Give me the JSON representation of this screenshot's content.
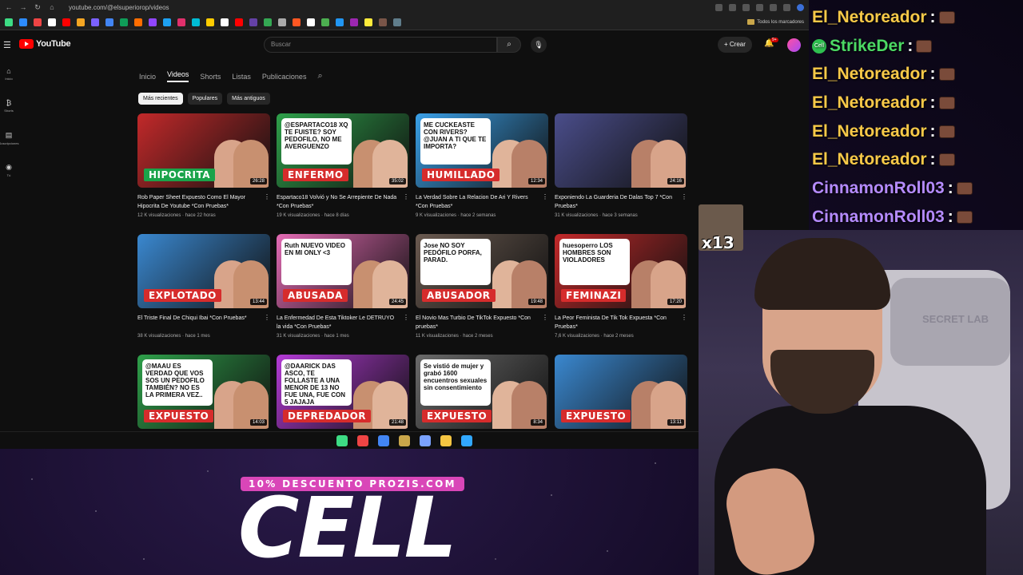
{
  "browser": {
    "url": "youtube.com/@elsuperiorop/videos",
    "bookmarks_folder": "Todos los marcadores",
    "bookmark_colors": [
      "#3ddc84",
      "#2d8cff",
      "#e44",
      "#fff",
      "#ff0000",
      "#f5a623",
      "#7b61ff",
      "#4285f4",
      "#0f9d58",
      "#ff6d00",
      "#9146ff",
      "#1da1f2",
      "#e1306c",
      "#00bcd4",
      "#ffcc00",
      "#fff",
      "#ff0000",
      "#6441a5",
      "#34a853",
      "#aaa",
      "#ff5722",
      "#fff",
      "#4caf50",
      "#2196f3",
      "#9c27b0",
      "#ffeb3b",
      "#795548",
      "#607d8b"
    ]
  },
  "youtube": {
    "logo": "YouTube",
    "search_placeholder": "Buscar",
    "create_label": "Crear",
    "bell_badge": "9+",
    "sidebar": [
      {
        "icon": "home-icon",
        "glyph": "⌂",
        "label": "Inicio"
      },
      {
        "icon": "shorts-icon",
        "glyph": "₿",
        "label": "Shorts"
      },
      {
        "icon": "subscriptions-icon",
        "glyph": "▤",
        "label": "Suscripciones"
      },
      {
        "icon": "you-icon",
        "glyph": "◉",
        "label": "Tú"
      }
    ],
    "tabs": [
      "Inicio",
      "Videos",
      "Shorts",
      "Listas",
      "Publicaciones"
    ],
    "active_tab": "Videos",
    "chips": [
      "Más recientes",
      "Populares",
      "Más antiguos"
    ],
    "videos": [
      {
        "title": "Rob Paper Sheet Expuesto Como El Mayor Hipocrita De Youtube *Con Pruebas*",
        "views": "12 K visualizaciones",
        "age": "hace 22 horas",
        "duration": "26:28",
        "tag": "HIPOCRITA",
        "tag_bg": "#1aa34a",
        "bg": "#c2292a",
        "tweet": ""
      },
      {
        "title": "Espartaco18 Volvió y No Se Arrepiente De Nada *Con Pruebas*",
        "views": "19 K visualizaciones",
        "age": "hace 8 días",
        "duration": "35:02",
        "tag": "ENFERMO",
        "tag_bg": "#d62c2c",
        "bg": "#2ea04a",
        "tweet": "@ESPARTACO18 XQ TE FUISTE? SOY PEDOFILO, NO ME AVERGUENZO"
      },
      {
        "title": "La Verdad Sobre La Relacion De Ari Y Rivers *Con Pruebas*",
        "views": "9 K visualizaciones",
        "age": "hace 2 semanas",
        "duration": "12:34",
        "tag": "HUMILLADO",
        "tag_bg": "#d62c2c",
        "bg": "#3aa0e8",
        "tweet": "ME CUCKEASTE CON RIVERS? @JUAN A TI QUE TE IMPORTA?"
      },
      {
        "title": "Exponiendo La Guarderia De Dalas Top 7 *Con Pruebas*",
        "views": "31 K visualizaciones",
        "age": "hace 3 semanas",
        "duration": "24:16",
        "tag": "",
        "tag_bg": "",
        "bg": "#4a4d8a",
        "tweet": ""
      },
      {
        "title": "El Triste Final De Chiqui Ibai *Con Pruebas*",
        "views": "38 K visualizaciones",
        "age": "hace 1 mes",
        "duration": "13:44",
        "tag": "EXPLOTADO",
        "tag_bg": "#d62c2c",
        "bg": "#3a88d0",
        "tweet": ""
      },
      {
        "title": "La Enfermedad De Esta Tiktoker Le DETRUYO la vida *Con Pruebas*",
        "views": "31 K visualizaciones",
        "age": "hace 1 mes",
        "duration": "24:45",
        "tag": "ABUSADA",
        "tag_bg": "#d62c2c",
        "bg": "#e46bb4",
        "tweet": "Ruth NUEVO VIDEO EN MI ONLY <3"
      },
      {
        "title": "El Novio Mas Turbio De TikTok Expuesto *Con pruebas*",
        "views": "11 K visualizaciones",
        "age": "hace 2 meses",
        "duration": "19:48",
        "tag": "ABUSADOR",
        "tag_bg": "#d62c2c",
        "bg": "#6a5a50",
        "tweet": "Jose NO SOY PEDÓFILO PORFA, PARAD."
      },
      {
        "title": "La Peor Feminista De Tik Tok Expuesta *Con Pruebas*",
        "views": "7,6 K visualizaciones",
        "age": "hace 2 meses",
        "duration": "17:20",
        "tag": "FEMINAZI",
        "tag_bg": "#d62c2c",
        "bg": "#c2292a",
        "tweet": "huesoperro LOS HOMBRES SON VIOLADORES"
      },
      {
        "title": "",
        "views": "",
        "age": "",
        "duration": "14:03",
        "tag": "EXPUESTO",
        "tag_bg": "#d62c2c",
        "bg": "#2ea04a",
        "tweet": "@MAAU ES VERDAD QUE VOS SOS UN PEDOFILO TAMBIÉN? NO ES LA PRIMERA VEZ.."
      },
      {
        "title": "",
        "views": "",
        "age": "",
        "duration": "21:48",
        "tag": "DEPREDADOR",
        "tag_bg": "#d62c2c",
        "bg": "#b33ad6",
        "tweet": "@DAARICK DAS ASCO, TE FOLLASTE A UNA MENOR DE 13 NO FUE UNA, FUE CON 5 JAJAJA"
      },
      {
        "title": "",
        "views": "",
        "age": "",
        "duration": "8:34",
        "tag": "EXPUESTO",
        "tag_bg": "#d62c2c",
        "bg": "#6a6a6a",
        "tweet": "Se vistió de mujer y grabó 1600 encuentros sexuales sin consentimiento"
      },
      {
        "title": "",
        "views": "",
        "age": "",
        "duration": "13:11",
        "tag": "EXPUESTO",
        "tag_bg": "#d62c2c",
        "bg": "#3a88d0",
        "tweet": ""
      }
    ]
  },
  "taskbar": [
    "#3ddc84",
    "#e44",
    "#4285f4",
    "#c9a64a",
    "#7aa2ff",
    "#f5c542",
    "#31a8ff"
  ],
  "chat": [
    {
      "user": "El_Netoreador",
      "color": "#f7c948",
      "badge": ""
    },
    {
      "user": "StrikeDer",
      "color": "#4cd964",
      "badge": "Cell"
    },
    {
      "user": "El_Netoreador",
      "color": "#f7c948",
      "badge": ""
    },
    {
      "user": "El_Netoreador",
      "color": "#f7c948",
      "badge": ""
    },
    {
      "user": "El_Netoreador",
      "color": "#f7c948",
      "badge": ""
    },
    {
      "user": "El_Netoreador",
      "color": "#f7c948",
      "badge": ""
    },
    {
      "user": "CinnamonRoll03",
      "color": "#b58bff",
      "badge": ""
    },
    {
      "user": "CinnamonRoll03",
      "color": "#b58bff",
      "badge": ""
    }
  ],
  "emote_counter": "x13",
  "webcam": {
    "chair_brand": "SECRET LAB"
  },
  "sponsor": {
    "promo": "10% DESCUENTO PROZIS.COM",
    "name": "CELL"
  }
}
